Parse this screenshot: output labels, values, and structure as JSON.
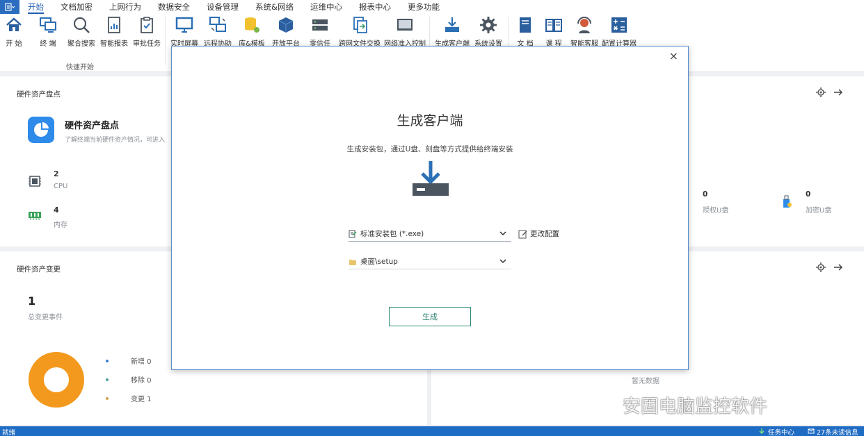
{
  "menu": {
    "items": [
      "开始",
      "文档加密",
      "上网行为",
      "数据安全",
      "设备管理",
      "系统&网络",
      "运维中心",
      "报表中心",
      "更多功能"
    ]
  },
  "ribbon": {
    "buttons": [
      {
        "label": "开 始",
        "icon": "home-icon"
      },
      {
        "label": "终 端",
        "icon": "terminals-icon"
      },
      {
        "label": "聚合搜索",
        "icon": "search-icon"
      },
      {
        "label": "智能报表",
        "icon": "report-icon"
      },
      {
        "label": "审批任务",
        "icon": "approval-icon"
      },
      {
        "label": "实时屏幕",
        "icon": "monitor-icon"
      },
      {
        "label": "远程协助",
        "icon": "remote-icon"
      },
      {
        "label": "库&模板",
        "icon": "database-icon"
      },
      {
        "label": "开放平台",
        "icon": "cube-icon"
      },
      {
        "label": "零信任",
        "icon": "server-icon"
      },
      {
        "label": "跨网文件交换",
        "icon": "file-exchange-icon"
      },
      {
        "label": "网络准入控制",
        "icon": "network-access-icon"
      },
      {
        "label": "生成客户端",
        "icon": "download-icon"
      },
      {
        "label": "系统设置",
        "icon": "gear-icon"
      },
      {
        "label": "文 档",
        "icon": "book-icon"
      },
      {
        "label": "课 程",
        "icon": "open-book-icon"
      },
      {
        "label": "智能客服",
        "icon": "headset-icon"
      },
      {
        "label": "配置计算器",
        "icon": "calculator-icon"
      }
    ],
    "group_label": "快速开始"
  },
  "hw_inventory": {
    "title": "硬件资产盘点",
    "card_title": "硬件资产盘点",
    "card_desc": "了解终端当前硬件资产情况，可进入",
    "cpu_value": "2",
    "cpu_label": "CPU",
    "mem_value": "4",
    "mem_label": "内存"
  },
  "right_top": {
    "auth_value": "0",
    "auth_label": "授权U盘",
    "enc_value": "0",
    "enc_label": "加密U盘"
  },
  "hw_change": {
    "title": "硬件资产变更",
    "total_value": "1",
    "total_label": "总变更事件",
    "legend": [
      {
        "label": "新增 0",
        "color": "#3a7bd5"
      },
      {
        "label": "移除 0",
        "color": "#4aa3a0"
      },
      {
        "label": "变更 1",
        "color": "#c8a64a"
      }
    ],
    "donut_color": "#f39a1e"
  },
  "right_bottom": {
    "empty_text": "暂无数据"
  },
  "modal": {
    "title": "生成客户端",
    "subtitle": "生成安装包，通过U盘、刻盘等方式提供给终端安装",
    "package_select": "标准安装包 (*.exe)",
    "path_select": "桌面\\setup",
    "change_config": "更改配置",
    "generate_button": "生成",
    "close": "×"
  },
  "status": {
    "left": "就绪",
    "task_center": "任务中心",
    "unread": "27条未读信息"
  },
  "watermark": "安固电脑监控软件",
  "colors": {
    "accent": "#1f5fb0",
    "status_bar": "#1f6cc4",
    "generate_border": "#2d8a78",
    "donut": "#f39a1e"
  }
}
